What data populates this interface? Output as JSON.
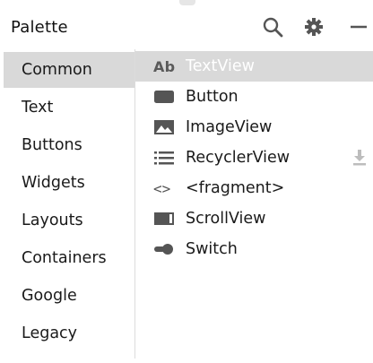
{
  "header": {
    "title": "Palette",
    "icons": [
      "search-icon",
      "gear-icon",
      "minimize-icon"
    ]
  },
  "categories": [
    {
      "label": "Common",
      "selected": true
    },
    {
      "label": "Text",
      "selected": false
    },
    {
      "label": "Buttons",
      "selected": false
    },
    {
      "label": "Widgets",
      "selected": false
    },
    {
      "label": "Layouts",
      "selected": false
    },
    {
      "label": "Containers",
      "selected": false
    },
    {
      "label": "Google",
      "selected": false
    },
    {
      "label": "Legacy",
      "selected": false
    }
  ],
  "components": [
    {
      "label": "TextView",
      "icon": "textview-icon",
      "icon_text": "Ab",
      "selected": true
    },
    {
      "label": "Button",
      "icon": "button-icon",
      "selected": false
    },
    {
      "label": "ImageView",
      "icon": "image-icon",
      "selected": false
    },
    {
      "label": "RecyclerView",
      "icon": "list-icon",
      "selected": false,
      "download_icon": "download-icon"
    },
    {
      "label": "<fragment>",
      "icon": "code-brackets-icon",
      "icon_text": "<>",
      "selected": false
    },
    {
      "label": "ScrollView",
      "icon": "scrollview-icon",
      "selected": false
    },
    {
      "label": "Switch",
      "icon": "switch-icon",
      "selected": false
    }
  ],
  "colors": {
    "selected_bg": "#d9d9d9",
    "icon_gray": "#555555",
    "divider": "#dcdcdc"
  }
}
